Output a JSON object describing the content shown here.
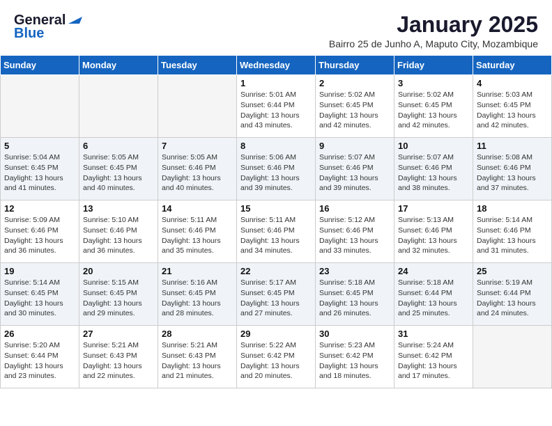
{
  "header": {
    "logo_line1": "General",
    "logo_line2": "Blue",
    "month_year": "January 2025",
    "subtitle": "Bairro 25 de Junho A, Maputo City, Mozambique"
  },
  "days_of_week": [
    "Sunday",
    "Monday",
    "Tuesday",
    "Wednesday",
    "Thursday",
    "Friday",
    "Saturday"
  ],
  "weeks": [
    [
      {
        "day": "",
        "text": ""
      },
      {
        "day": "",
        "text": ""
      },
      {
        "day": "",
        "text": ""
      },
      {
        "day": "1",
        "text": "Sunrise: 5:01 AM\nSunset: 6:44 PM\nDaylight: 13 hours and 43 minutes."
      },
      {
        "day": "2",
        "text": "Sunrise: 5:02 AM\nSunset: 6:45 PM\nDaylight: 13 hours and 42 minutes."
      },
      {
        "day": "3",
        "text": "Sunrise: 5:02 AM\nSunset: 6:45 PM\nDaylight: 13 hours and 42 minutes."
      },
      {
        "day": "4",
        "text": "Sunrise: 5:03 AM\nSunset: 6:45 PM\nDaylight: 13 hours and 42 minutes."
      }
    ],
    [
      {
        "day": "5",
        "text": "Sunrise: 5:04 AM\nSunset: 6:45 PM\nDaylight: 13 hours and 41 minutes."
      },
      {
        "day": "6",
        "text": "Sunrise: 5:05 AM\nSunset: 6:45 PM\nDaylight: 13 hours and 40 minutes."
      },
      {
        "day": "7",
        "text": "Sunrise: 5:05 AM\nSunset: 6:46 PM\nDaylight: 13 hours and 40 minutes."
      },
      {
        "day": "8",
        "text": "Sunrise: 5:06 AM\nSunset: 6:46 PM\nDaylight: 13 hours and 39 minutes."
      },
      {
        "day": "9",
        "text": "Sunrise: 5:07 AM\nSunset: 6:46 PM\nDaylight: 13 hours and 39 minutes."
      },
      {
        "day": "10",
        "text": "Sunrise: 5:07 AM\nSunset: 6:46 PM\nDaylight: 13 hours and 38 minutes."
      },
      {
        "day": "11",
        "text": "Sunrise: 5:08 AM\nSunset: 6:46 PM\nDaylight: 13 hours and 37 minutes."
      }
    ],
    [
      {
        "day": "12",
        "text": "Sunrise: 5:09 AM\nSunset: 6:46 PM\nDaylight: 13 hours and 36 minutes."
      },
      {
        "day": "13",
        "text": "Sunrise: 5:10 AM\nSunset: 6:46 PM\nDaylight: 13 hours and 36 minutes."
      },
      {
        "day": "14",
        "text": "Sunrise: 5:11 AM\nSunset: 6:46 PM\nDaylight: 13 hours and 35 minutes."
      },
      {
        "day": "15",
        "text": "Sunrise: 5:11 AM\nSunset: 6:46 PM\nDaylight: 13 hours and 34 minutes."
      },
      {
        "day": "16",
        "text": "Sunrise: 5:12 AM\nSunset: 6:46 PM\nDaylight: 13 hours and 33 minutes."
      },
      {
        "day": "17",
        "text": "Sunrise: 5:13 AM\nSunset: 6:46 PM\nDaylight: 13 hours and 32 minutes."
      },
      {
        "day": "18",
        "text": "Sunrise: 5:14 AM\nSunset: 6:46 PM\nDaylight: 13 hours and 31 minutes."
      }
    ],
    [
      {
        "day": "19",
        "text": "Sunrise: 5:14 AM\nSunset: 6:45 PM\nDaylight: 13 hours and 30 minutes."
      },
      {
        "day": "20",
        "text": "Sunrise: 5:15 AM\nSunset: 6:45 PM\nDaylight: 13 hours and 29 minutes."
      },
      {
        "day": "21",
        "text": "Sunrise: 5:16 AM\nSunset: 6:45 PM\nDaylight: 13 hours and 28 minutes."
      },
      {
        "day": "22",
        "text": "Sunrise: 5:17 AM\nSunset: 6:45 PM\nDaylight: 13 hours and 27 minutes."
      },
      {
        "day": "23",
        "text": "Sunrise: 5:18 AM\nSunset: 6:45 PM\nDaylight: 13 hours and 26 minutes."
      },
      {
        "day": "24",
        "text": "Sunrise: 5:18 AM\nSunset: 6:44 PM\nDaylight: 13 hours and 25 minutes."
      },
      {
        "day": "25",
        "text": "Sunrise: 5:19 AM\nSunset: 6:44 PM\nDaylight: 13 hours and 24 minutes."
      }
    ],
    [
      {
        "day": "26",
        "text": "Sunrise: 5:20 AM\nSunset: 6:44 PM\nDaylight: 13 hours and 23 minutes."
      },
      {
        "day": "27",
        "text": "Sunrise: 5:21 AM\nSunset: 6:43 PM\nDaylight: 13 hours and 22 minutes."
      },
      {
        "day": "28",
        "text": "Sunrise: 5:21 AM\nSunset: 6:43 PM\nDaylight: 13 hours and 21 minutes."
      },
      {
        "day": "29",
        "text": "Sunrise: 5:22 AM\nSunset: 6:42 PM\nDaylight: 13 hours and 20 minutes."
      },
      {
        "day": "30",
        "text": "Sunrise: 5:23 AM\nSunset: 6:42 PM\nDaylight: 13 hours and 18 minutes."
      },
      {
        "day": "31",
        "text": "Sunrise: 5:24 AM\nSunset: 6:42 PM\nDaylight: 13 hours and 17 minutes."
      },
      {
        "day": "",
        "text": ""
      }
    ]
  ]
}
